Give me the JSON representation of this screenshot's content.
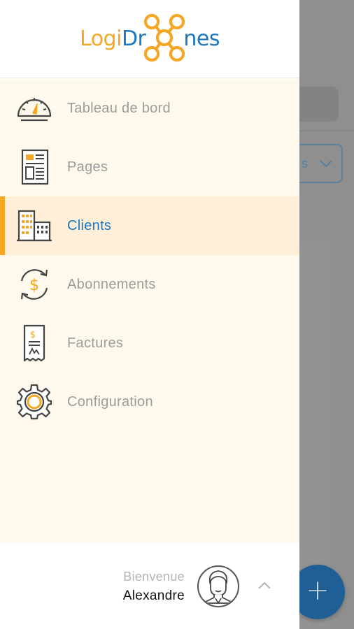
{
  "brand": {
    "part1": "Logi",
    "part2": "Dr",
    "part3": "nes",
    "colors": {
      "orange": "#f5a623",
      "blue": "#1b78c1"
    }
  },
  "menu": [
    {
      "label": "Tableau de bord",
      "icon": "dashboard-gauge-icon",
      "active": false
    },
    {
      "label": "Pages",
      "icon": "pages-document-icon",
      "active": false
    },
    {
      "label": "Clients",
      "icon": "clients-buildings-icon",
      "active": true
    },
    {
      "label": "Abonnements",
      "icon": "subscription-dollar-cycle-icon",
      "active": false
    },
    {
      "label": "Factures",
      "icon": "invoice-receipt-icon",
      "active": false
    },
    {
      "label": "Configuration",
      "icon": "gear-icon",
      "active": false
    }
  ],
  "footer": {
    "greeting": "Bienvenue",
    "user_name": "Alexandre",
    "avatar_icon": "user-avatar-icon",
    "toggle_icon": "chevron-up-icon"
  },
  "background": {
    "select_value": "s",
    "fab_icon": "plus-icon",
    "fab_color": "#1f5f96"
  }
}
